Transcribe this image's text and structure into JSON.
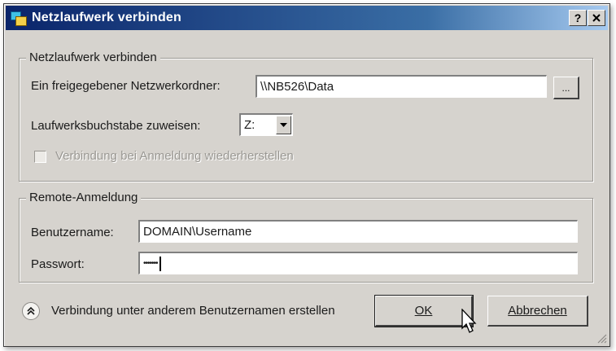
{
  "window": {
    "title": "Netzlaufwerk verbinden",
    "help_label": "?",
    "close_label": "✕"
  },
  "connect_group": {
    "legend": "Netzlaufwerk verbinden",
    "folder_label": "Ein freigegebener Netzwerkordner:",
    "folder_value": "\\\\NB526\\Data",
    "browse_label": "...",
    "drive_label": "Laufwerksbuchstabe zuweisen:",
    "drive_value": "Z:",
    "reconnect_label": "Verbindung bei Anmeldung wiederherstellen"
  },
  "remote_group": {
    "legend": "Remote-Anmeldung",
    "username_label": "Benutzername:",
    "username_value": "DOMAIN\\Username",
    "password_label": "Passwort:",
    "password_value": "•••••••"
  },
  "footer": {
    "other_user_label": "Verbindung unter anderem Benutzernamen erstellen",
    "ok_label": "OK",
    "cancel_label": "Abbrechen"
  }
}
